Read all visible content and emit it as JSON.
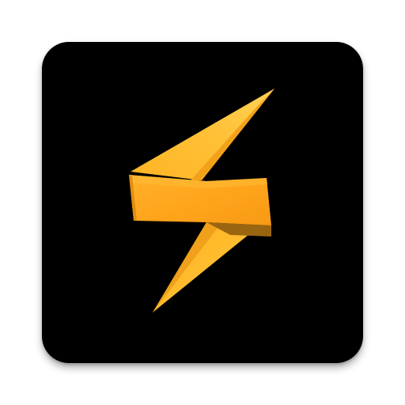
{
  "app_icon": {
    "glyph": "lightning-bolt-icon",
    "colors": {
      "tile_background": "#000000",
      "bolt_primary": "#FFA81E",
      "bolt_highlight": "#FFC640",
      "bolt_shadow": "#C87F16",
      "bolt_dark_fold": "#9A6510"
    }
  }
}
